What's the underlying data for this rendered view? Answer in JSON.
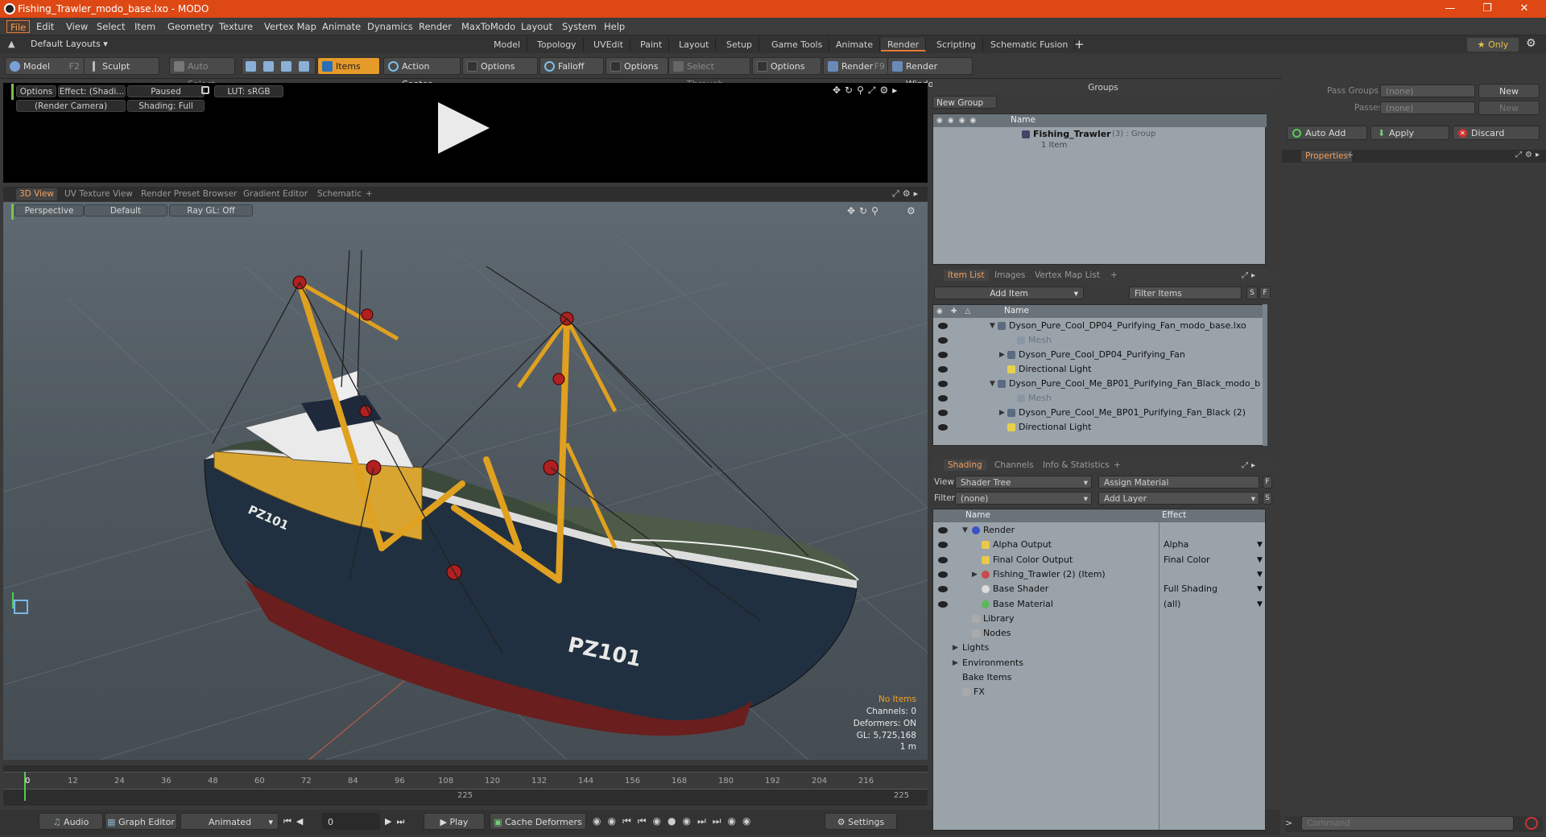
{
  "window": {
    "title": "Fishing_Trawler_modo_base.lxo - MODO",
    "controls": [
      "—",
      "❐",
      "✕"
    ]
  },
  "menu": [
    "File",
    "Edit",
    "View",
    "Select",
    "Item",
    "Geometry",
    "Texture",
    "Vertex Map",
    "Animate",
    "Dynamics",
    "Render",
    "MaxToModo",
    "Layout",
    "System",
    "Help"
  ],
  "layout": {
    "selector": "Default Layouts ▾",
    "tabs": [
      "Model",
      "Topology",
      "UVEdit",
      "Paint",
      "Layout",
      "Setup",
      "Game Tools",
      "Animate",
      "Render",
      "Scripting",
      "Schematic Fusion"
    ],
    "active_tab": "Render",
    "only_label": "★ Only"
  },
  "toolbar": {
    "model": "Model",
    "model_key": "F2",
    "sculpt": "Sculpt",
    "auto_select": "Auto Select",
    "items": "Items",
    "action_center": "Action Center",
    "options1": "Options",
    "falloff": "Falloff",
    "options2": "Options",
    "select_through": "Select Through",
    "options3": "Options",
    "render": "Render",
    "render_key": "F9",
    "render_window": "Render Window"
  },
  "render_view": {
    "options": "Options",
    "effect": "Effect: (Shadi...",
    "paused": "Paused",
    "lut": "LUT: sRGB",
    "camera": "(Render Camera)",
    "shading": "Shading: Full"
  },
  "viewport_tabs": [
    "3D View",
    "UV Texture View",
    "Render Preset Browser",
    "Gradient Editor",
    "Schematic",
    "+"
  ],
  "viewport": {
    "perspective": "Perspective",
    "default": "Default",
    "raygl": "Ray GL: Off",
    "hull_text": "PZ101",
    "hull_small": "PZ101",
    "no_items": "No Items",
    "channels": "Channels: 0",
    "deformers": "Deformers: ON",
    "gl": "GL: 5,725,168",
    "scale": "1 m"
  },
  "timeline": {
    "ticks": [
      "0",
      "12",
      "24",
      "36",
      "48",
      "60",
      "72",
      "84",
      "96",
      "108",
      "120",
      "132",
      "144",
      "156",
      "168",
      "180",
      "192",
      "204",
      "216"
    ],
    "end_left": "225",
    "end_right": "225"
  },
  "bottom": {
    "audio": "Audio",
    "graph_editor": "Graph Editor",
    "animated": "Animated",
    "frame": "0",
    "play": "Play",
    "cache": "Cache Deformers",
    "settings": "Settings",
    "command_placeholder": "Command"
  },
  "groups": {
    "title": "Groups",
    "new_group": "New Group",
    "col_name": "Name",
    "item_name": "Fishing_Trawler",
    "item_suffix": "(3) : Group",
    "item_sub": "1 Item"
  },
  "passes": {
    "pass_groups": "Pass Groups",
    "passes": "Passes",
    "none1": "(none)",
    "none2": "(none)",
    "new1": "New",
    "new2": "New",
    "auto_add": "Auto Add",
    "apply": "Apply",
    "discard": "Discard",
    "properties": "Properties"
  },
  "item_list": {
    "tabs": [
      "Item List",
      "Images",
      "Vertex Map List",
      "+"
    ],
    "add_item": "Add Item",
    "filter": "Filter Items",
    "col_name": "Name",
    "rows": [
      {
        "text": "Dyson_Pure_Cool_DP04_Purifying_Fan_modo_base.lxo",
        "indent": 0,
        "gray": false
      },
      {
        "text": "Mesh",
        "indent": 2,
        "gray": true
      },
      {
        "text": "Dyson_Pure_Cool_DP04_Purifying_Fan",
        "indent": 1,
        "gray": false
      },
      {
        "text": "Directional Light",
        "indent": 1,
        "gray": false
      },
      {
        "text": "Dyson_Pure_Cool_Me_BP01_Purifying_Fan_Black_modo_b ...",
        "indent": 0,
        "gray": false
      },
      {
        "text": "Mesh",
        "indent": 2,
        "gray": true
      },
      {
        "text": "Dyson_Pure_Cool_Me_BP01_Purifying_Fan_Black (2)",
        "indent": 1,
        "gray": false
      },
      {
        "text": "Directional Light",
        "indent": 1,
        "gray": false
      }
    ]
  },
  "shading": {
    "tabs": [
      "Shading",
      "Channels",
      "Info & Statistics",
      "+"
    ],
    "view_label": "View",
    "view_value": "Shader Tree",
    "assign": "Assign Material",
    "filter_label": "Filter",
    "filter_value": "(none)",
    "add_layer": "Add Layer",
    "col_name": "Name",
    "col_effect": "Effect",
    "rows": [
      {
        "name": "Render",
        "effect": "",
        "indent": 1
      },
      {
        "name": "Alpha Output",
        "effect": "Alpha",
        "indent": 2
      },
      {
        "name": "Final Color Output",
        "effect": "Final Color",
        "indent": 2
      },
      {
        "name": "Fishing_Trawler (2) (Item)",
        "effect": "",
        "indent": 2
      },
      {
        "name": "Base Shader",
        "effect": "Full Shading",
        "indent": 2
      },
      {
        "name": "Base Material",
        "effect": "(all)",
        "indent": 2
      },
      {
        "name": "Library",
        "effect": "",
        "indent": 1
      },
      {
        "name": "Nodes",
        "effect": "",
        "indent": 1
      },
      {
        "name": "Lights",
        "effect": "",
        "indent": 0
      },
      {
        "name": "Environments",
        "effect": "",
        "indent": 0
      },
      {
        "name": "Bake Items",
        "effect": "",
        "indent": 0
      },
      {
        "name": "FX",
        "effect": "",
        "indent": 0
      }
    ]
  },
  "colors": {
    "accent": "#e07a3a",
    "titlebar": "#dd4814",
    "items_btn": "#e59a2a",
    "panel_bg": "#9aa3aa"
  }
}
